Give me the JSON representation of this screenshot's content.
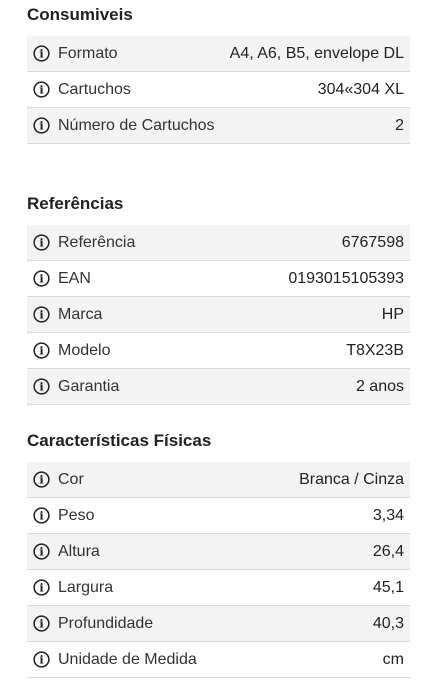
{
  "sections": [
    {
      "title": "Consumiveis",
      "rows": [
        {
          "label": "Formato",
          "value": "A4, A6, B5, envelope DL"
        },
        {
          "label": "Cartuchos",
          "value": "304«304 XL"
        },
        {
          "label": "Número de Cartuchos",
          "value": "2"
        }
      ]
    },
    {
      "title": "Referências",
      "rows": [
        {
          "label": "Referência",
          "value": "6767598"
        },
        {
          "label": "EAN",
          "value": "0193015105393"
        },
        {
          "label": "Marca",
          "value": "HP"
        },
        {
          "label": "Modelo",
          "value": "T8X23B"
        },
        {
          "label": "Garantia",
          "value": "2 anos"
        }
      ]
    },
    {
      "title": "Características Físicas",
      "rows": [
        {
          "label": "Cor",
          "value": "Branca / Cinza"
        },
        {
          "label": "Peso",
          "value": "3,34"
        },
        {
          "label": "Altura",
          "value": "26,4"
        },
        {
          "label": "Largura",
          "value": "45,1"
        },
        {
          "label": "Profundidade",
          "value": "40,3"
        },
        {
          "label": "Unidade de Medida",
          "value": "cm"
        }
      ]
    }
  ],
  "icons": {
    "info": "info-circle-icon"
  },
  "colors": {
    "row_shade": "#f3f3f3",
    "divider": "#d9d9d9",
    "text": "#222222"
  }
}
